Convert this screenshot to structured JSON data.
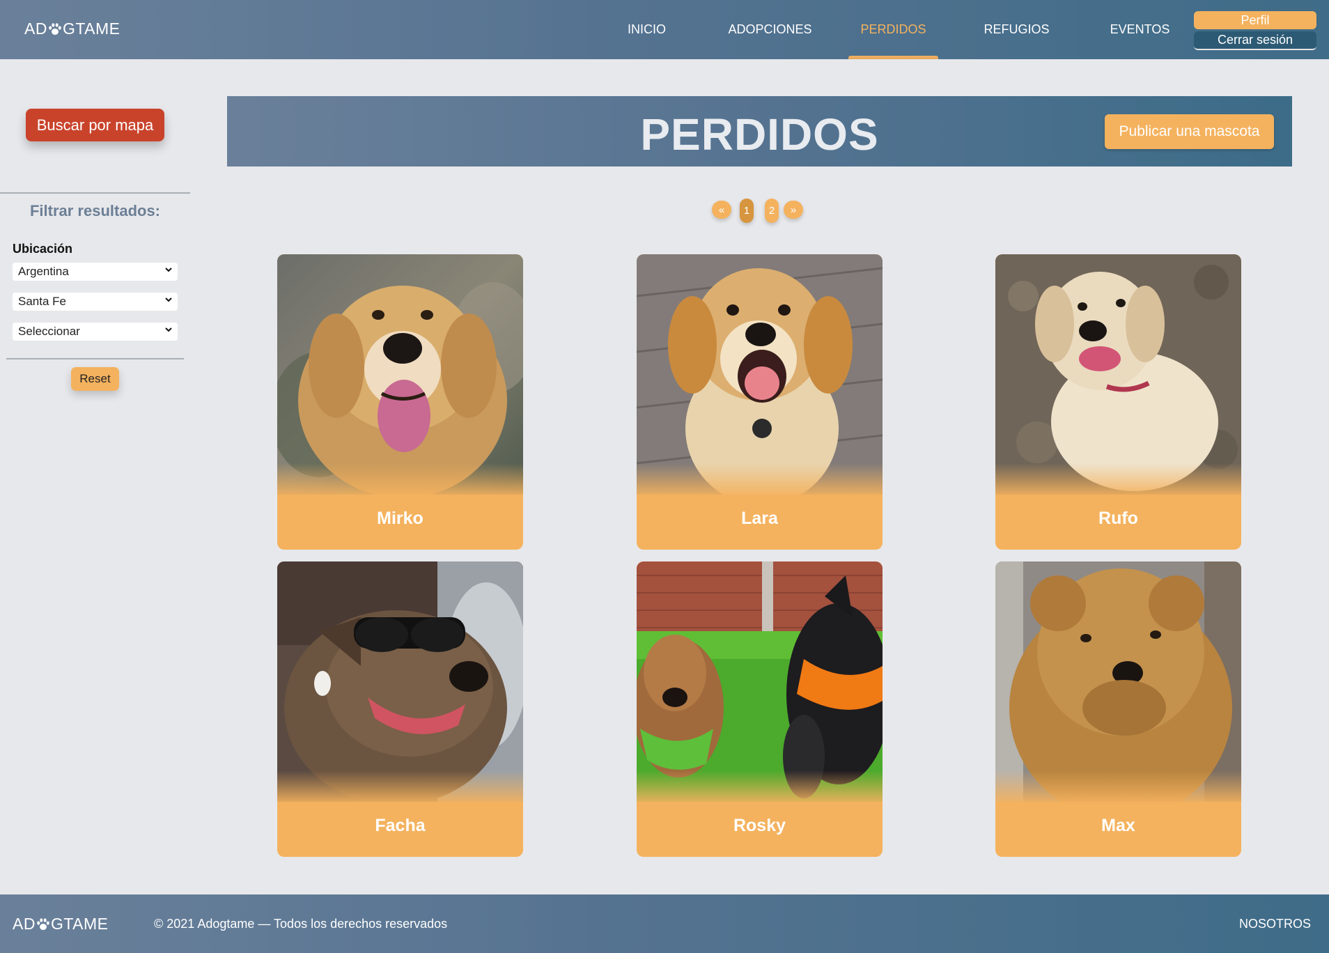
{
  "brand": {
    "logo_left": "AD",
    "logo_right": "GTAME",
    "logo_icon": "paw-icon"
  },
  "nav": {
    "items": [
      {
        "label": "INICIO",
        "active": false
      },
      {
        "label": "ADOPCIONES",
        "active": false
      },
      {
        "label": "PERDIDOS",
        "active": true
      },
      {
        "label": "REFUGIOS",
        "active": false
      },
      {
        "label": "EVENTOS",
        "active": false
      }
    ],
    "profile_label": "Perfil",
    "logout_label": "Cerrar sesión"
  },
  "sidebar": {
    "map_button": "Buscar por mapa",
    "filter_title": "Filtrar resultados:",
    "location_label": "Ubicación",
    "selects": [
      {
        "value": "Argentina"
      },
      {
        "value": "Santa Fe"
      },
      {
        "value": "Seleccionar"
      }
    ],
    "reset_label": "Reset"
  },
  "banner": {
    "title": "PERDIDOS",
    "publish_button": "Publicar una mascota"
  },
  "pagination": {
    "prev": "«",
    "pages": [
      "1",
      "2"
    ],
    "current": "1",
    "next": "»"
  },
  "pets": [
    {
      "name": "Mirko"
    },
    {
      "name": "Lara"
    },
    {
      "name": "Rufo"
    },
    {
      "name": "Facha"
    },
    {
      "name": "Rosky"
    },
    {
      "name": "Max"
    }
  ],
  "footer": {
    "copyright": "© 2021 Adogtame — Todos los derechos reservados",
    "about_link": "NOSOTROS"
  },
  "colors": {
    "accent": "#f4b25e",
    "header_start": "#6a809a",
    "header_end": "#3f6c88",
    "map_button": "#c9432b",
    "background": "#e7e8eb"
  }
}
